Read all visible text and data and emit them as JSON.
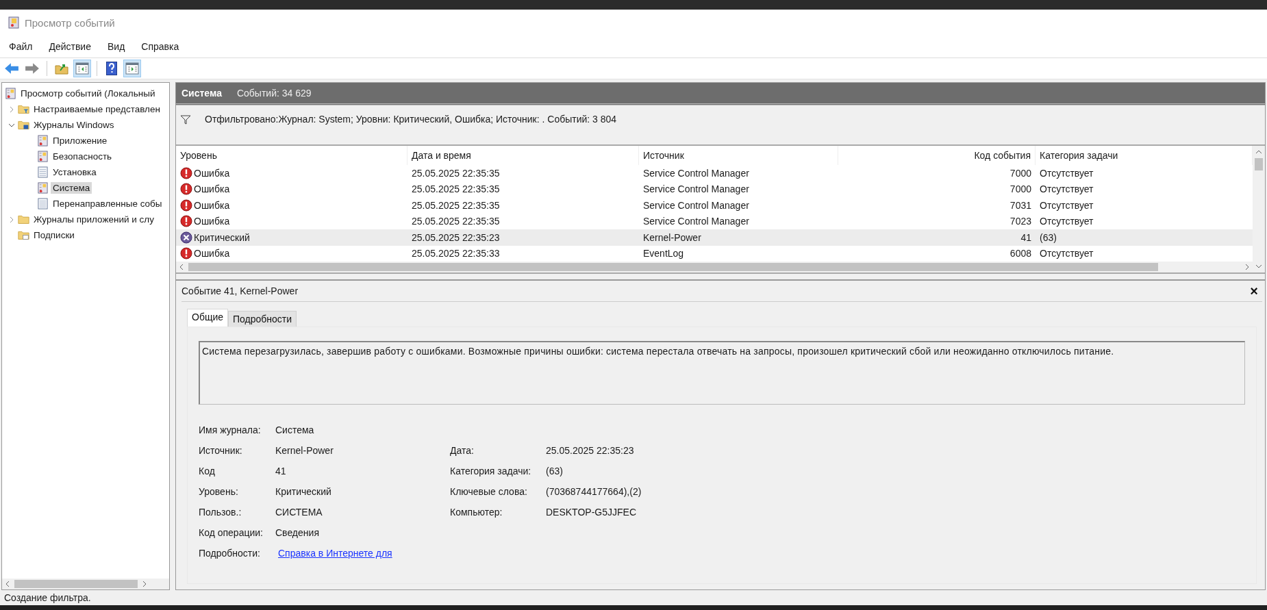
{
  "window": {
    "title": "Просмотр событий"
  },
  "menu": [
    "Файл",
    "Действие",
    "Вид",
    "Справка"
  ],
  "toolbar": [
    {
      "kind": "back",
      "on": false
    },
    {
      "kind": "forward",
      "on": false
    },
    {
      "kind": "up",
      "on": false
    },
    {
      "kind": "tree",
      "on": true
    },
    {
      "kind": "help",
      "on": false
    },
    {
      "kind": "actions",
      "on": true
    }
  ],
  "sidebar": {
    "items": [
      {
        "label": "Просмотр событий (Локальный",
        "kind": "root",
        "selected": false,
        "children": [
          {
            "label": "Настраиваемые представлен",
            "kind": "filter-folder",
            "selected": false,
            "expanded": false
          },
          {
            "label": "Журналы Windows",
            "kind": "win-folder",
            "selected": false,
            "expanded": true,
            "children": [
              {
                "label": "Приложение",
                "kind": "log",
                "selected": false
              },
              {
                "label": "Безопасность",
                "kind": "log",
                "selected": false
              },
              {
                "label": "Установка",
                "kind": "plain-log",
                "selected": false
              },
              {
                "label": "Система",
                "kind": "log",
                "selected": true
              },
              {
                "label": "Перенаправленные собы",
                "kind": "plain-log",
                "selected": false
              }
            ]
          },
          {
            "label": "Журналы приложений и слу",
            "kind": "folder",
            "selected": false,
            "expanded": false
          },
          {
            "label": "Подписки",
            "kind": "sub-folder",
            "selected": false
          }
        ]
      }
    ]
  },
  "pane": {
    "title": "Система",
    "count": "Событий: 34 629",
    "filter": "Отфильтровано:Журнал: System; Уровни: Критический, Ошибка; Источник: . Событий: 3 804"
  },
  "table": {
    "columns": [
      "Уровень",
      "Дата и время",
      "Источник",
      "Код события",
      "Категория задачи"
    ],
    "rows": [
      {
        "kind": "error",
        "level": "Ошибка",
        "date": "25.05.2025 22:35:35",
        "source": "Service Control Manager",
        "code": "7000",
        "category": "Отсутствует",
        "selected": false
      },
      {
        "kind": "error",
        "level": "Ошибка",
        "date": "25.05.2025 22:35:35",
        "source": "Service Control Manager",
        "code": "7000",
        "category": "Отсутствует",
        "selected": false
      },
      {
        "kind": "error",
        "level": "Ошибка",
        "date": "25.05.2025 22:35:35",
        "source": "Service Control Manager",
        "code": "7031",
        "category": "Отсутствует",
        "selected": false
      },
      {
        "kind": "error",
        "level": "Ошибка",
        "date": "25.05.2025 22:35:35",
        "source": "Service Control Manager",
        "code": "7023",
        "category": "Отсутствует",
        "selected": false
      },
      {
        "kind": "critical",
        "level": "Критический",
        "date": "25.05.2025 22:35:23",
        "source": "Kernel-Power",
        "code": "41",
        "category": "(63)",
        "selected": true
      },
      {
        "kind": "error",
        "level": "Ошибка",
        "date": "25.05.2025 22:35:33",
        "source": "EventLog",
        "code": "6008",
        "category": "Отсутствует",
        "selected": false
      }
    ]
  },
  "details": {
    "title": "Событие 41, Kernel-Power",
    "close": "×",
    "tabs": [
      {
        "label": "Общие",
        "selected": true
      },
      {
        "label": "Подробности",
        "selected": false
      }
    ],
    "description": "Система перезагрузилась, завершив работу с ошибками. Возможные причины ошибки: система перестала отвечать на запросы, произошел критический сбой или неожиданно отключилось питание.",
    "fields": [
      {
        "label": "Имя журнала:",
        "value": "Система"
      },
      {
        "label": "Источник:",
        "value": "Kernel-Power"
      },
      {
        "label": "Код",
        "value": "41"
      },
      {
        "label": "Уровень:",
        "value": "Критический"
      },
      {
        "label": "Пользов.:",
        "value": "СИСТЕМА"
      },
      {
        "label": "Код операции:",
        "value": "Сведения"
      }
    ],
    "fields_right": [
      {
        "label": "Дата:",
        "value": "25.05.2025 22:35:23"
      },
      {
        "label": "Категория задачи:",
        "value": "(63)"
      },
      {
        "label": "Ключевые слова:",
        "value": "(70368744177664),(2)"
      },
      {
        "label": "Компьютер:",
        "value": "DESKTOP-G5JJFEC"
      }
    ],
    "more_info": {
      "label": "Подробности:",
      "link": "Справка в Интернете для"
    }
  },
  "status_bar": "Создание фильтра."
}
